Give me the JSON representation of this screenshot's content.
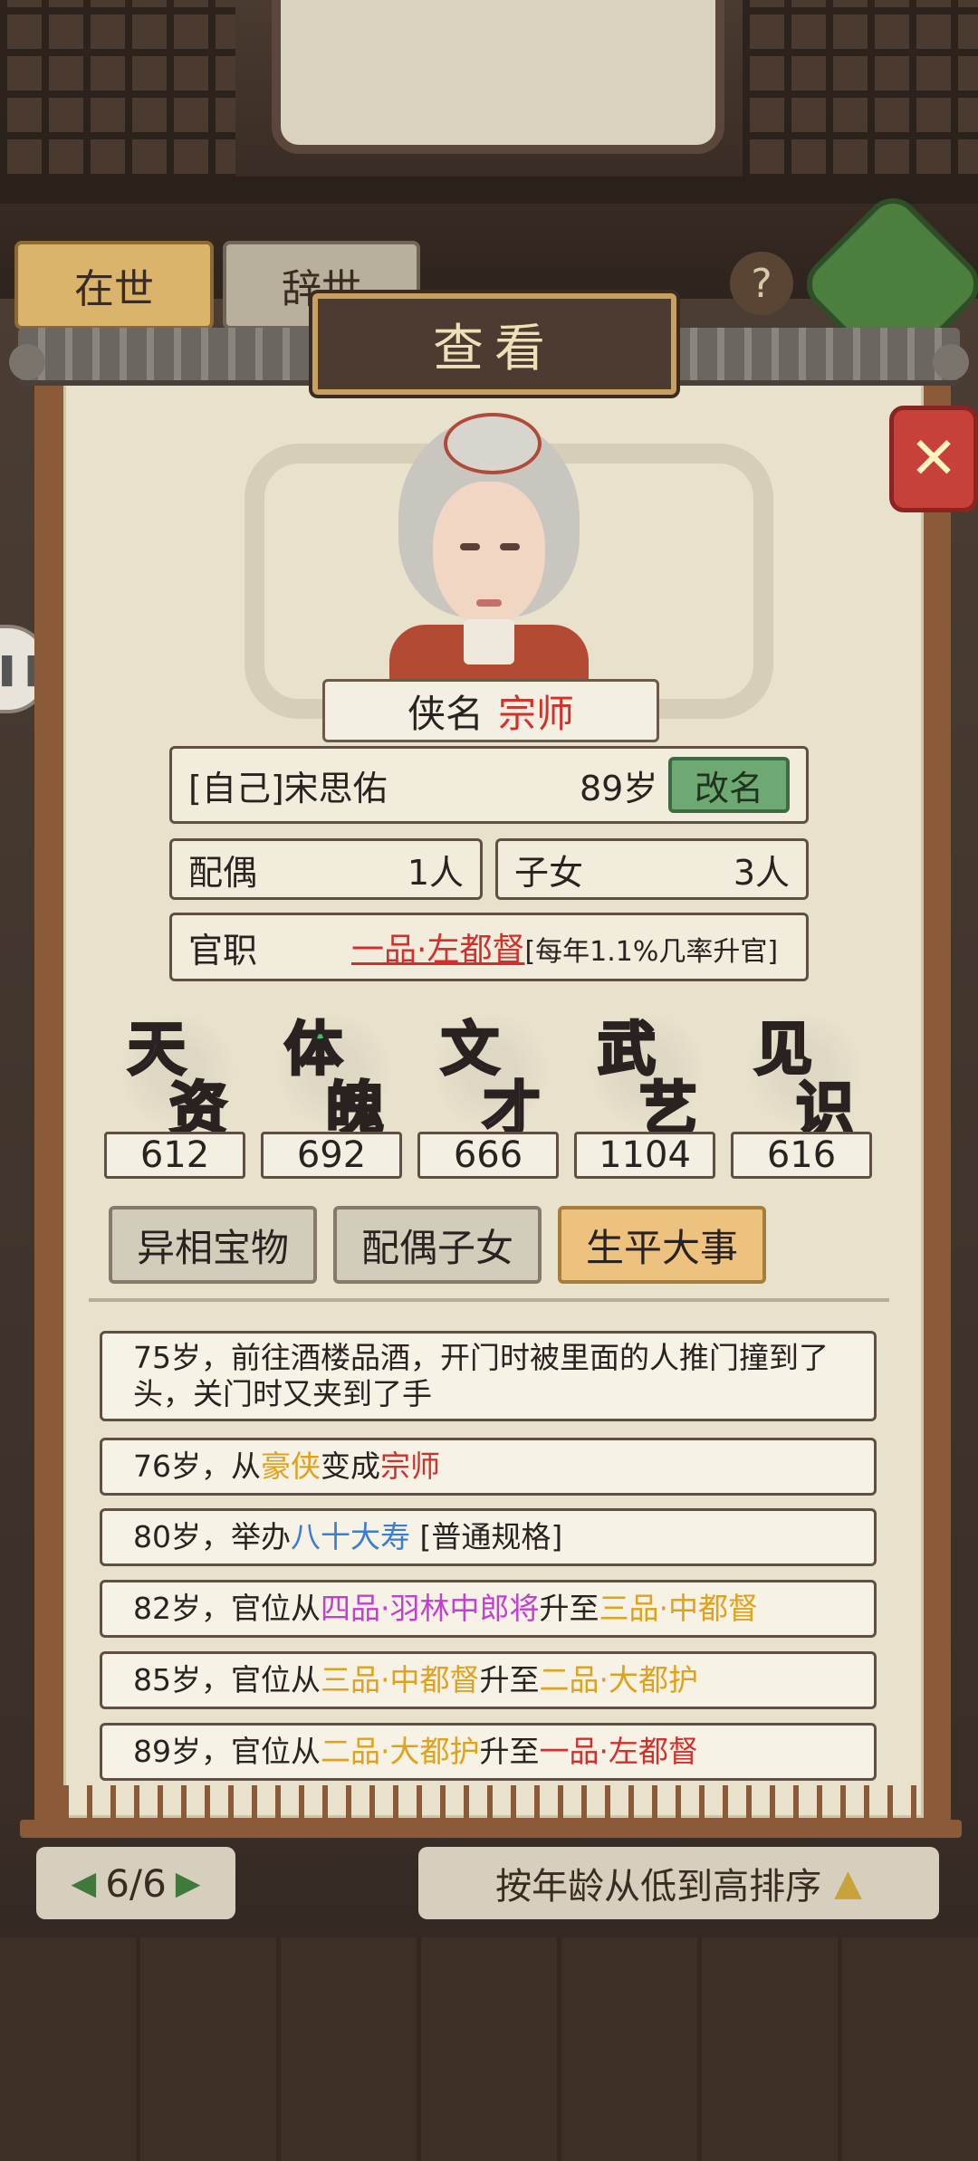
{
  "background": {
    "tab_alive": "在世",
    "tab_deceased": "辞世",
    "help_icon": "?",
    "page_indicator": "6/6",
    "sort_label": "按年龄从低到高排序"
  },
  "modal": {
    "title": "查看",
    "close_icon": "close-icon",
    "hero_title_label": "侠名",
    "hero_title_value": "宗师",
    "name": "[自己]宋思佑",
    "age": "89岁",
    "rename_button": "改名",
    "spouse_label": "配偶",
    "spouse_count": "1人",
    "children_label": "子女",
    "children_count": "3人",
    "office_label": "官职",
    "office_value": "一品·左都督",
    "office_note": "[每年1.1%几率升官]"
  },
  "stats": [
    {
      "c1": "天",
      "c2": "资",
      "value": "612",
      "color": "#3a6fe0"
    },
    {
      "c1": "体",
      "c2": "魄",
      "value": "692",
      "color": "#3fbf6a"
    },
    {
      "c1": "文",
      "c2": "才",
      "value": "666",
      "color": "#b34ed8"
    },
    {
      "c1": "武",
      "c2": "艺",
      "value": "1104",
      "color": "#e3a72a"
    },
    {
      "c1": "见",
      "c2": "识",
      "value": "616",
      "color": "#e0604a"
    }
  ],
  "tabs": {
    "treasures": "异相宝物",
    "family": "配偶子女",
    "life_events": "生平大事"
  },
  "events": [
    {
      "parts": [
        {
          "t": "75岁，前往酒楼品酒，开门时被里面的人推门撞到了头，关门时又夹到了手",
          "c": ""
        }
      ]
    },
    {
      "parts": [
        {
          "t": "76岁，从",
          "c": ""
        },
        {
          "t": "豪侠",
          "c": "gold"
        },
        {
          "t": "变成",
          "c": ""
        },
        {
          "t": "宗师",
          "c": "red"
        }
      ]
    },
    {
      "parts": [
        {
          "t": "80岁，举办",
          "c": ""
        },
        {
          "t": "八十大寿",
          "c": "blue"
        },
        {
          "t": " [普通规格]",
          "c": ""
        }
      ]
    },
    {
      "parts": [
        {
          "t": "82岁，官位从",
          "c": ""
        },
        {
          "t": "四品·羽林中郎将",
          "c": "purple"
        },
        {
          "t": "升至",
          "c": ""
        },
        {
          "t": "三品·中都督",
          "c": "gold"
        }
      ]
    },
    {
      "parts": [
        {
          "t": "85岁，官位从",
          "c": ""
        },
        {
          "t": "三品·中都督",
          "c": "gold"
        },
        {
          "t": "升至",
          "c": ""
        },
        {
          "t": "二品·大都护",
          "c": "gold"
        }
      ]
    },
    {
      "parts": [
        {
          "t": "89岁，官位从",
          "c": ""
        },
        {
          "t": "二品·大都护",
          "c": "gold"
        },
        {
          "t": "升至",
          "c": ""
        },
        {
          "t": "一品·左都督",
          "c": "red"
        }
      ]
    }
  ]
}
